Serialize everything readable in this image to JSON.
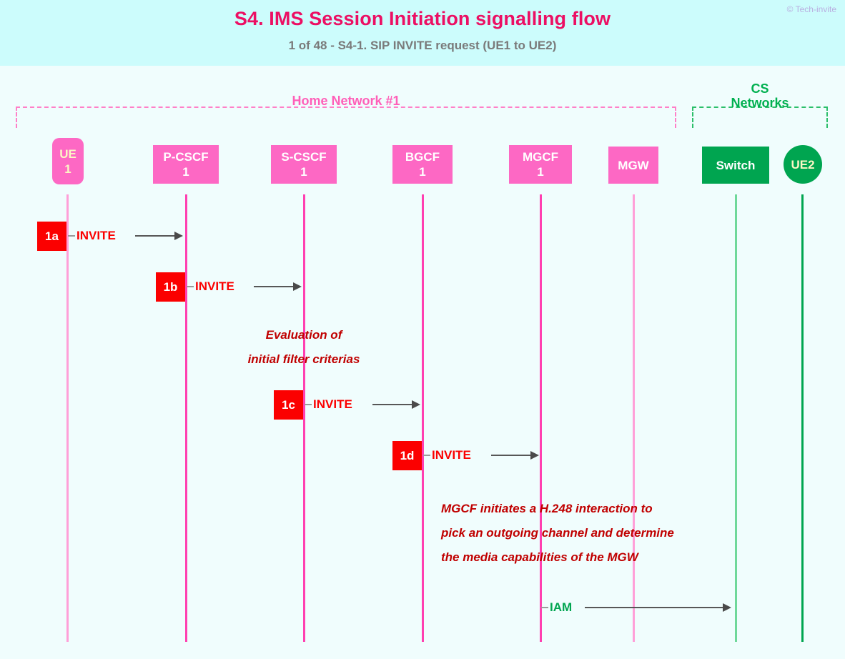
{
  "header": {
    "title": "S4. IMS Session Initiation signalling flow",
    "subtitle": "1 of 48 - S4-1. SIP INVITE request (UE1 to UE2)",
    "copyright": "© Tech-invite"
  },
  "groups": [
    {
      "id": "home-network",
      "label": "Home Network #1",
      "color": "#ff5fb8"
    },
    {
      "id": "cs-networks",
      "label": "CS\nNetworks",
      "label_line1": "CS",
      "label_line2": "Networks",
      "color": "#00b050"
    }
  ],
  "entities": [
    {
      "id": "ue1",
      "name": "UE",
      "num": "1",
      "shape": "rounded",
      "color": "#fd68c4"
    },
    {
      "id": "pcscf1",
      "name": "P-CSCF",
      "num": "1",
      "shape": "rect",
      "color": "#fd68c4"
    },
    {
      "id": "scscf1",
      "name": "S-CSCF",
      "num": "1",
      "shape": "rect",
      "color": "#fd68c4"
    },
    {
      "id": "bgcf1",
      "name": "BGCF",
      "num": "1",
      "shape": "rect",
      "color": "#fd68c4"
    },
    {
      "id": "mgcf1",
      "name": "MGCF",
      "num": "1",
      "shape": "rect",
      "color": "#fd68c4"
    },
    {
      "id": "mgw",
      "name": "MGW",
      "num": "",
      "shape": "rect",
      "color": "#fd68c4"
    },
    {
      "id": "switch",
      "name": "Switch",
      "num": "",
      "shape": "rect",
      "color": "#00a550"
    },
    {
      "id": "ue2",
      "name": "UE2",
      "num": "",
      "shape": "circle",
      "color": "#00a550"
    }
  ],
  "messages": [
    {
      "id": "m1a",
      "seq": "1a",
      "label": "INVITE",
      "from": "ue1",
      "to": "pcscf1"
    },
    {
      "id": "m1b",
      "seq": "1b",
      "label": "INVITE",
      "from": "pcscf1",
      "to": "scscf1"
    },
    {
      "id": "m1c",
      "seq": "1c",
      "label": "INVITE",
      "from": "scscf1",
      "to": "bgcf1"
    },
    {
      "id": "m1d",
      "seq": "1d",
      "label": "INVITE",
      "from": "bgcf1",
      "to": "mgcf1"
    },
    {
      "id": "miam",
      "seq": "",
      "label": "IAM",
      "from": "mgcf1",
      "to": "switch"
    }
  ],
  "notes": [
    {
      "id": "note-ifc",
      "line1": "Evaluation of",
      "line2": "initial filter criterias"
    },
    {
      "id": "note-mgcf",
      "line1": "MGCF initiates a H.248 interaction to",
      "line2": "pick an outgoing channel and determine",
      "line3": "the media capabilities of the MGW"
    }
  ],
  "colors": {
    "background": "#f0fdfd",
    "header_band": "#ccfcfc",
    "title": "#ec0f63",
    "subtitle": "#7a7a7a",
    "pink": "#fd68c4",
    "green": "#00a550",
    "seq_box": "#fb0000",
    "note_text": "#c00000"
  }
}
